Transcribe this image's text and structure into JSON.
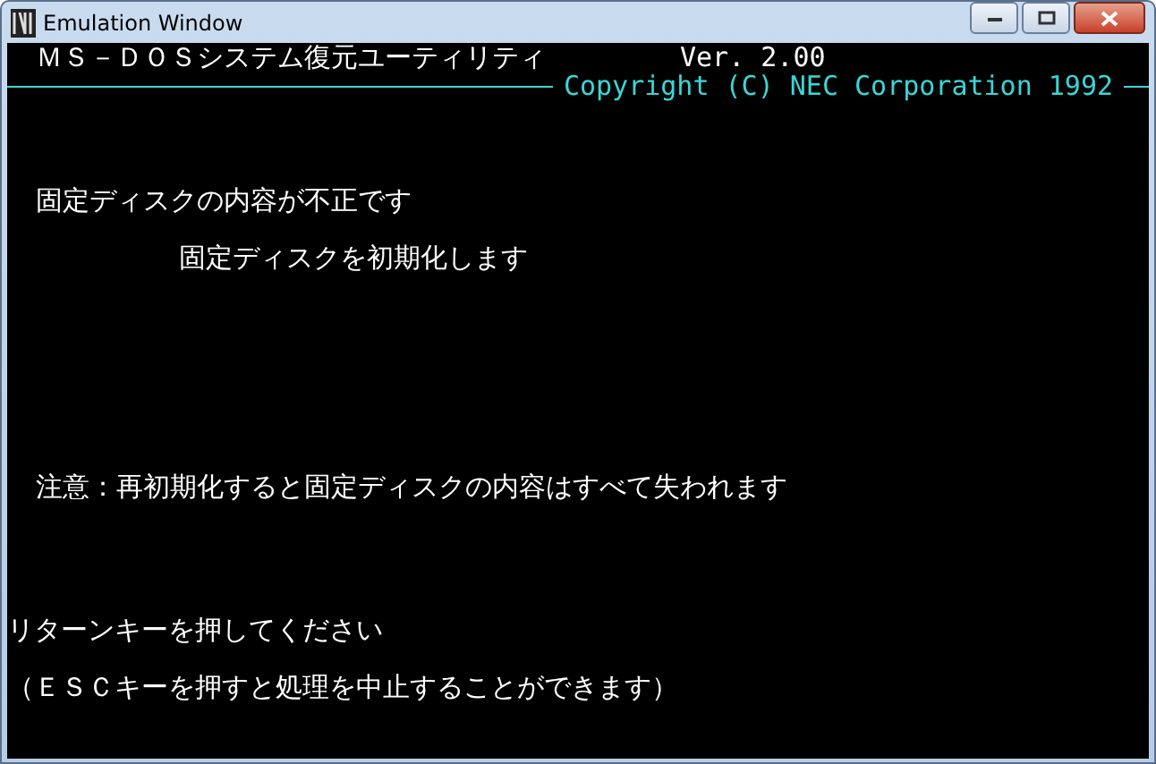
{
  "window": {
    "title": "Emulation Window"
  },
  "header": {
    "title": "ＭＳ－ＤＯＳシステム復元ユーティリティ",
    "version": "Ver. 2.00",
    "copyright": "Copyright (C) NEC Corporation 1992"
  },
  "messages": [
    {
      "kind": "error",
      "text": "固定ディスクの内容が不正です"
    },
    {
      "kind": "action",
      "text": "固定ディスクを初期化します"
    },
    {
      "kind": "warning",
      "text": "注意：再初期化すると固定ディスクの内容はすべて失われます"
    },
    {
      "kind": "prompt",
      "text": "リターンキーを押してください"
    },
    {
      "kind": "hint",
      "text": "（ＥＳＣキーを押すと処理を中止することができます）"
    }
  ]
}
